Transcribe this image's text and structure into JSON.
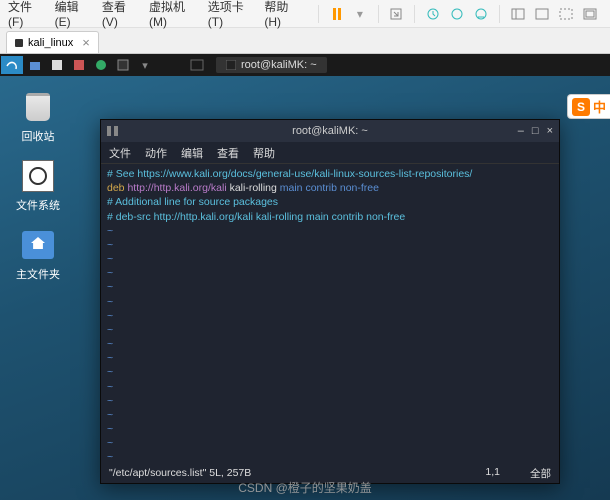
{
  "menubar": {
    "items": [
      "文件(F)",
      "编辑(E)",
      "查看(V)",
      "虚拟机(M)",
      "选项卡(T)",
      "帮助(H)"
    ]
  },
  "tab": {
    "label": "kali_linux",
    "close": "×"
  },
  "taskbar": {
    "task_label": "root@kaliMK: ~"
  },
  "desktop_icons": {
    "trash": "回收站",
    "filesystem": "文件系统",
    "home": "主文件夹"
  },
  "sogou": {
    "s": "S",
    "zh": "中"
  },
  "terminal": {
    "title": "root@kaliMK: ~",
    "menu": [
      "文件",
      "动作",
      "编辑",
      "查看",
      "帮助"
    ],
    "win_btns": {
      "min": "–",
      "max": "□",
      "close": "×"
    },
    "lines": [
      {
        "parts": [
          {
            "cls": "c-cyan",
            "t": "# "
          },
          {
            "cls": "c-cyan",
            "t": "See https://www.kali.org/docs/general-use/kali-linux-sources-list-repositories/"
          }
        ]
      },
      {
        "parts": [
          {
            "cls": "c-yellow",
            "t": "deb "
          },
          {
            "cls": "c-purple",
            "t": "http://http.kali.org/kali"
          },
          {
            "cls": "c-white",
            "t": " kali-rolling "
          },
          {
            "cls": "c-blue",
            "t": "main contrib non-free"
          }
        ]
      },
      {
        "parts": [
          {
            "cls": "",
            "t": ""
          }
        ]
      },
      {
        "parts": [
          {
            "cls": "c-cyan",
            "t": "# Additional line for source packages"
          }
        ]
      },
      {
        "parts": [
          {
            "cls": "c-cyan",
            "t": "# deb-src http://http.kali.org/kali kali-rolling main contrib non-free"
          }
        ]
      }
    ],
    "tilde_count": 17,
    "status": {
      "file": "\"/etc/apt/sources.list\" 5L, 257B",
      "pos": "1,1",
      "mode": "全部"
    }
  },
  "watermark": "CSDN @橙子的坚果奶盖"
}
